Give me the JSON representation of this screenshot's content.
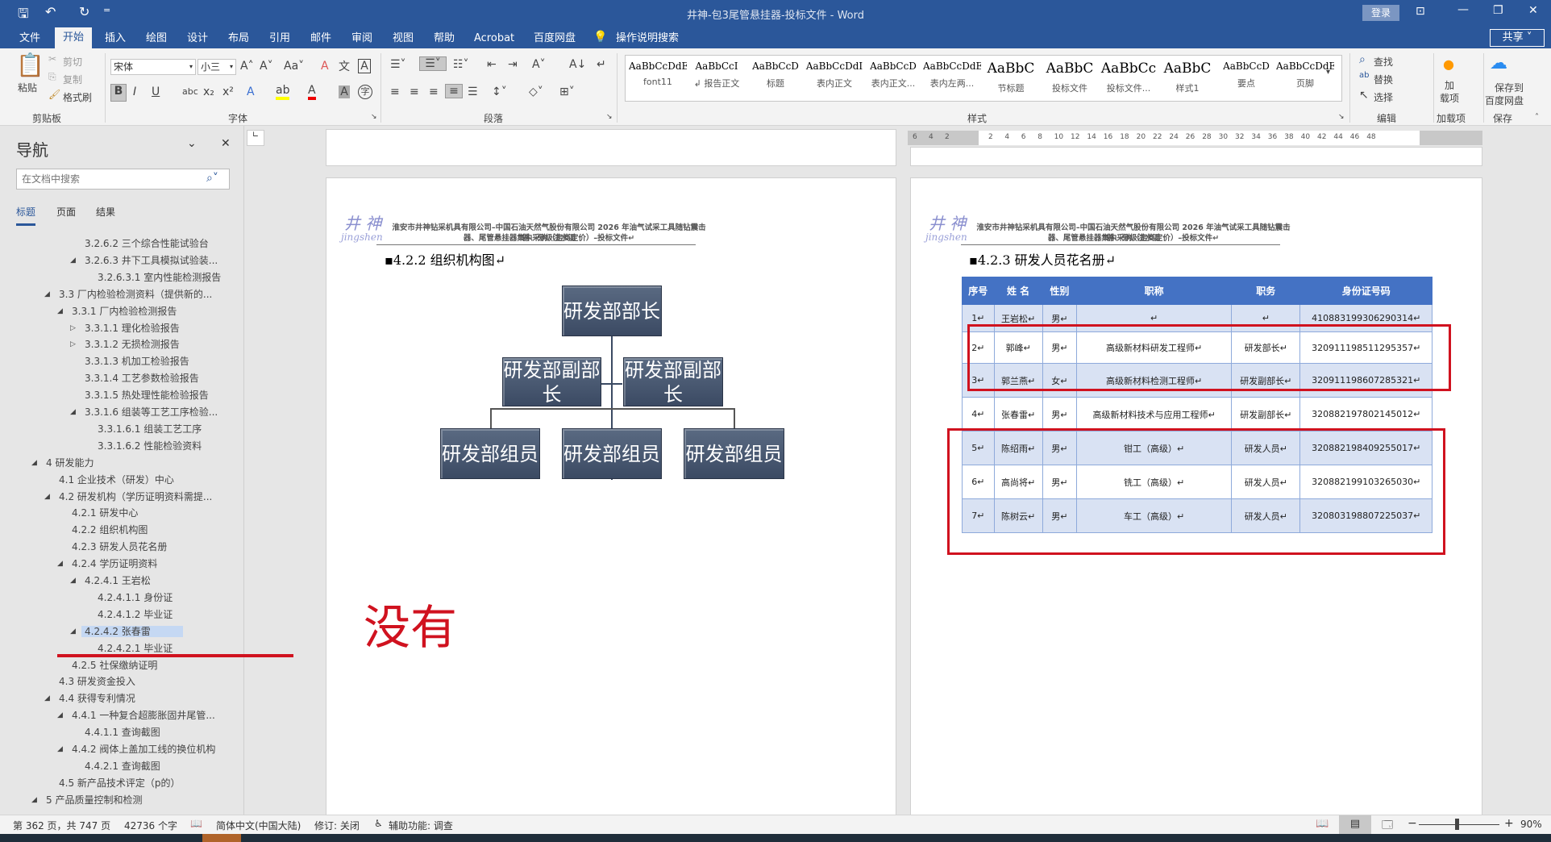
{
  "title": "井神-包3尾管悬挂器-投标文件  -  Word",
  "titlebar": {
    "login": "登录"
  },
  "tabs": [
    "文件",
    "开始",
    "插入",
    "绘图",
    "设计",
    "布局",
    "引用",
    "邮件",
    "审阅",
    "视图",
    "帮助",
    "Acrobat",
    "百度网盘",
    "操作说明搜索"
  ],
  "share": "共享",
  "clipboard": {
    "paste": "粘贴",
    "cut": "剪切",
    "copy": "复制",
    "format_painter": "格式刷",
    "label": "剪贴板"
  },
  "font": {
    "name": "宋体",
    "size": "小三",
    "label": "字体"
  },
  "paragraph": {
    "label": "段落"
  },
  "styles": {
    "label": "样式",
    "items": [
      {
        "preview": "AaBbCcDdEe",
        "name": "font11"
      },
      {
        "preview": "AaBbCcI",
        "name": "↲ 报告正文"
      },
      {
        "preview": "AaBbCcD",
        "name": "标题"
      },
      {
        "preview": "AaBbCcDdI",
        "name": "表内正文"
      },
      {
        "preview": "AaBbCcD",
        "name": "表内正文..."
      },
      {
        "preview": "AaBbCcDdEe",
        "name": "表内左两..."
      },
      {
        "preview": "AaBbC",
        "name": "节标题"
      },
      {
        "preview": "AaBbC",
        "name": "投标文件"
      },
      {
        "preview": "AaBbCc",
        "name": "投标文件..."
      },
      {
        "preview": "AaBbC",
        "name": "样式1"
      },
      {
        "preview": "AaBbCcD",
        "name": "要点"
      },
      {
        "preview": "AaBbCcDdE",
        "name": "页脚"
      }
    ]
  },
  "editing": {
    "find": "查找",
    "replace": "替换",
    "select": "选择",
    "label": "编辑"
  },
  "addins": {
    "btn": "加\n载项",
    "label": "加载项"
  },
  "baidu": {
    "btn1": "保存到",
    "btn2": "百度网盘",
    "label": "保存"
  },
  "nav": {
    "title": "导航",
    "search_placeholder": "在文档中搜索",
    "tabs": [
      "标题",
      "页面",
      "结果"
    ],
    "items": [
      {
        "text": "3.2.6.2 三个综合性能试验台",
        "level": 3,
        "state": ""
      },
      {
        "text": "3.2.6.3 井下工具模拟试验装...",
        "level": 3,
        "state": "expanded"
      },
      {
        "text": "3.2.6.3.1 室内性能检测报告",
        "level": 4,
        "state": ""
      },
      {
        "text": "3.3 厂内检验检测资料（提供新的...",
        "level": 1,
        "state": "expanded"
      },
      {
        "text": "3.3.1 厂内检验检测报告",
        "level": 2,
        "state": "expanded"
      },
      {
        "text": "3.3.1.1 理化检验报告",
        "level": 3,
        "state": "collapsed"
      },
      {
        "text": "3.3.1.2 无损检测报告",
        "level": 3,
        "state": "collapsed"
      },
      {
        "text": "3.3.1.3 机加工检验报告",
        "level": 3,
        "state": ""
      },
      {
        "text": "3.3.1.4 工艺参数检验报告",
        "level": 3,
        "state": ""
      },
      {
        "text": "3.3.1.5 热处理性能检验报告",
        "level": 3,
        "state": ""
      },
      {
        "text": "3.3.1.6 组装等工艺工序检验...",
        "level": 3,
        "state": "expanded"
      },
      {
        "text": "3.3.1.6.1 组装工艺工序",
        "level": 4,
        "state": ""
      },
      {
        "text": "3.3.1.6.2 性能检验资料",
        "level": 4,
        "state": ""
      },
      {
        "text": "4 研发能力",
        "level": 0,
        "state": "expanded"
      },
      {
        "text": "4.1 企业技术（研发）中心",
        "level": 1,
        "state": ""
      },
      {
        "text": "4.2 研发机构（学历证明资料需提...",
        "level": 1,
        "state": "expanded"
      },
      {
        "text": "4.2.1 研发中心",
        "level": 2,
        "state": ""
      },
      {
        "text": "4.2.2 组织机构图",
        "level": 2,
        "state": ""
      },
      {
        "text": "4.2.3 研发人员花名册",
        "level": 2,
        "state": ""
      },
      {
        "text": "4.2.4 学历证明资料",
        "level": 2,
        "state": "expanded"
      },
      {
        "text": "4.2.4.1 王岩松",
        "level": 3,
        "state": "expanded"
      },
      {
        "text": "4.2.4.1.1 身份证",
        "level": 4,
        "state": ""
      },
      {
        "text": "4.2.4.1.2 毕业证",
        "level": 4,
        "state": ""
      },
      {
        "text": "4.2.4.2 张春雷",
        "level": 3,
        "state": "expanded",
        "selected": true
      },
      {
        "text": "4.2.4.2.1 毕业证",
        "level": 4,
        "state": ""
      },
      {
        "text": "4.2.5 社保缴纳证明",
        "level": 2,
        "state": ""
      },
      {
        "text": "4.3 研发资金投入",
        "level": 1,
        "state": ""
      },
      {
        "text": "4.4 获得专利情况",
        "level": 1,
        "state": "expanded"
      },
      {
        "text": "4.4.1 一种复合超膨胀固井尾管...",
        "level": 2,
        "state": "expanded"
      },
      {
        "text": "4.4.1.1 查询截图",
        "level": 3,
        "state": ""
      },
      {
        "text": "4.4.2 阀体上盖加工线的换位机构",
        "level": 2,
        "state": "expanded"
      },
      {
        "text": "4.4.2.1 查询截图",
        "level": 3,
        "state": ""
      },
      {
        "text": "4.5 新产品技术评定（p的）",
        "level": 1,
        "state": ""
      },
      {
        "text": "5 产品质量控制和检测",
        "level": 0,
        "state": "expanded"
      }
    ]
  },
  "page_header": {
    "line1": "淮安市井神钻采机具有限公司–中国石油天然气股份有限公司 2026 年油气试采工具随钻震击器、分级注水泥",
    "line2": "器、尾管悬挂器集中采购（定商定价）–投标文件↵",
    "logo_cn": "井 神",
    "logo_en": "jingshen"
  },
  "left_page": {
    "heading": "4.2.2 组织机构图↵",
    "annotation": "没有",
    "org": {
      "head": "研发部部长",
      "deputies": [
        "研发部副部长",
        "研发部副部长"
      ],
      "members": [
        "研发部组员",
        "研发部组员",
        "研发部组员"
      ]
    }
  },
  "right_page": {
    "heading": "4.2.3 研发人员花名册↵",
    "table": {
      "headers": [
        "序号",
        "姓 名",
        "性别",
        "职称",
        "职务",
        "身份证号码"
      ],
      "rows": [
        [
          "1↵",
          "王岩松↵",
          "男↵",
          "↵",
          "↵",
          "410883199306290314↵"
        ],
        [
          "2↵",
          "郭峰↵",
          "男↵",
          "高级新材料研发工程师↵",
          "研发部长↵",
          "320911198511295357↵"
        ],
        [
          "3↵",
          "郭兰燕↵",
          "女↵",
          "高级新材料检测工程师↵",
          "研发副部长↵",
          "320911198607285321↵"
        ],
        [
          "4↵",
          "张春雷↵",
          "男↵",
          "高级新材料技术与应用工程师↵",
          "研发副部长↵",
          "320882197802145012↵"
        ],
        [
          "5↵",
          "陈绍雨↵",
          "男↵",
          "钳工（高级）↵",
          "研发人员↵",
          "320882198409255017↵"
        ],
        [
          "6↵",
          "高尚将↵",
          "男↵",
          "铣工（高级）↵",
          "研发人员↵",
          "320882199103265030↵"
        ],
        [
          "7↵",
          "陈树云↵",
          "男↵",
          "车工（高级）↵",
          "研发人员↵",
          "320803198807225037↵"
        ]
      ]
    }
  },
  "ruler": [
    "6",
    "4",
    "2",
    "2",
    "4",
    "6",
    "8",
    "10",
    "12",
    "14",
    "16",
    "18",
    "20",
    "22",
    "24",
    "26",
    "28",
    "30",
    "32",
    "34",
    "36",
    "38",
    "40",
    "42",
    "44",
    "46",
    "48"
  ],
  "status": {
    "page": "第 362 页，共 747 页",
    "words": "42736 个字",
    "lang": "简体中文(中国大陆)",
    "track": "修订: 关闭",
    "access": "辅助功能: 调查",
    "zoom": "90%",
    "zoom_fraction": 0.45
  },
  "colors": {
    "word_blue": "#2b579a",
    "table_header": "#4472c4",
    "band": "#d9e2f3",
    "annotation_red": "#d0121f"
  }
}
